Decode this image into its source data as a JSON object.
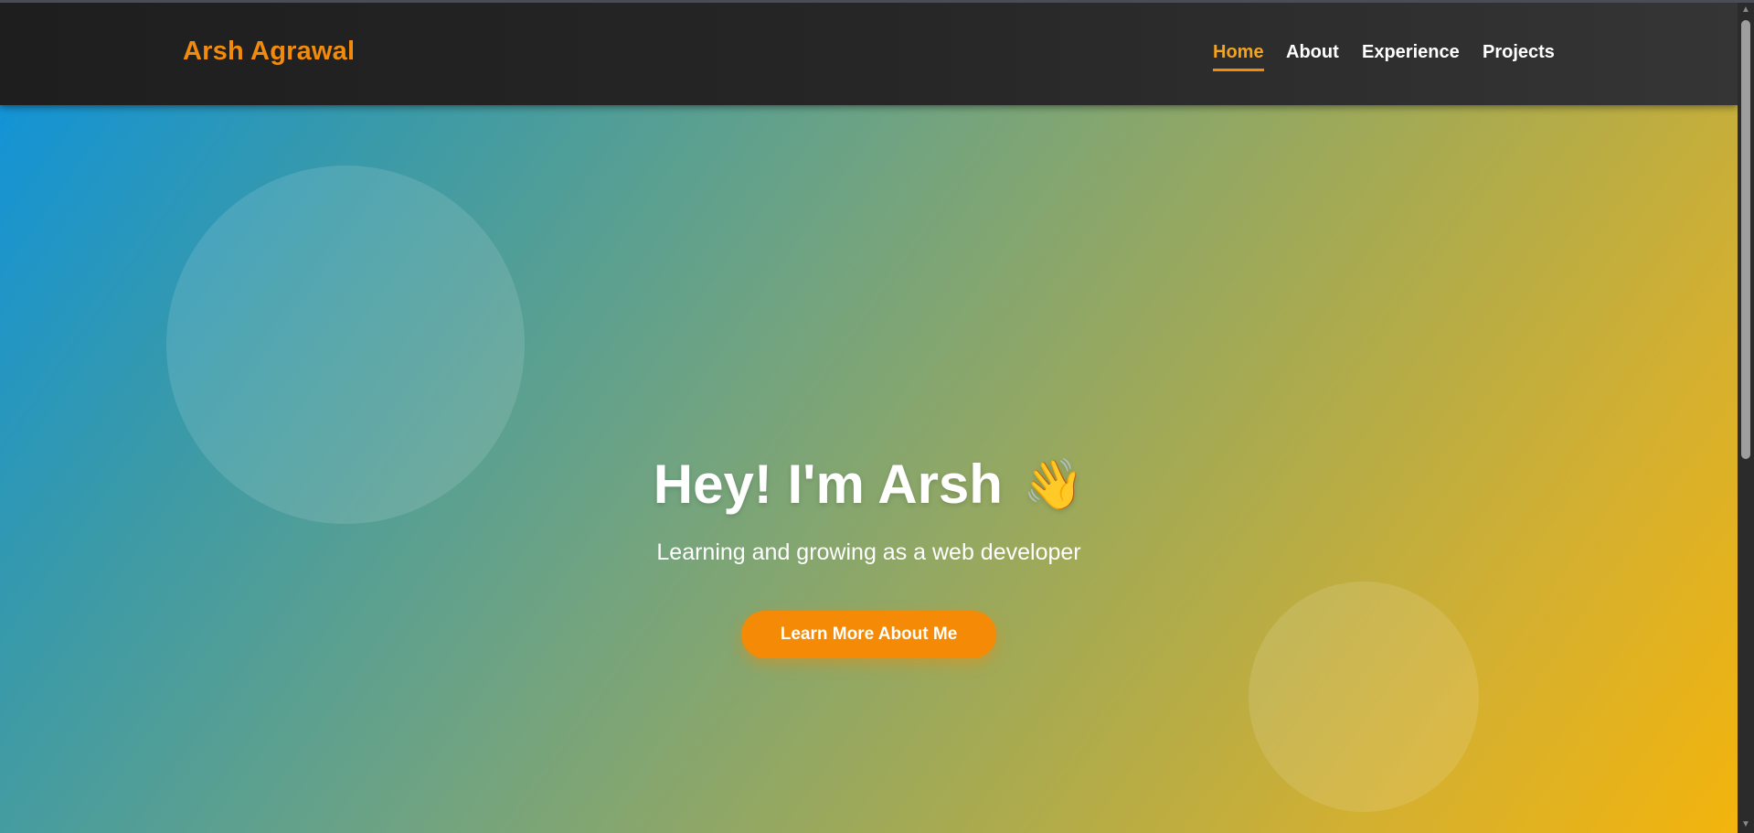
{
  "header": {
    "brand": "Arsh Agrawal",
    "nav": [
      {
        "label": "Home",
        "active": true
      },
      {
        "label": "About",
        "active": false
      },
      {
        "label": "Experience",
        "active": false
      },
      {
        "label": "Projects",
        "active": false
      }
    ]
  },
  "hero": {
    "title": "Hey! I'm Arsh",
    "wave_emoji": "👋",
    "subtitle": "Learning and growing as a web developer",
    "cta_label": "Learn More About Me"
  },
  "colors": {
    "header_bg": "#262626",
    "brand": "#f28a0c",
    "nav_active": "#f5a31a",
    "cta_bg": "#f58a06",
    "hero_gradient_start": "#1393d6",
    "hero_gradient_end": "#f3b40c"
  },
  "icons": {
    "scroll_up": "scroll-up-arrow-icon",
    "scroll_down": "scroll-down-arrow-icon"
  }
}
